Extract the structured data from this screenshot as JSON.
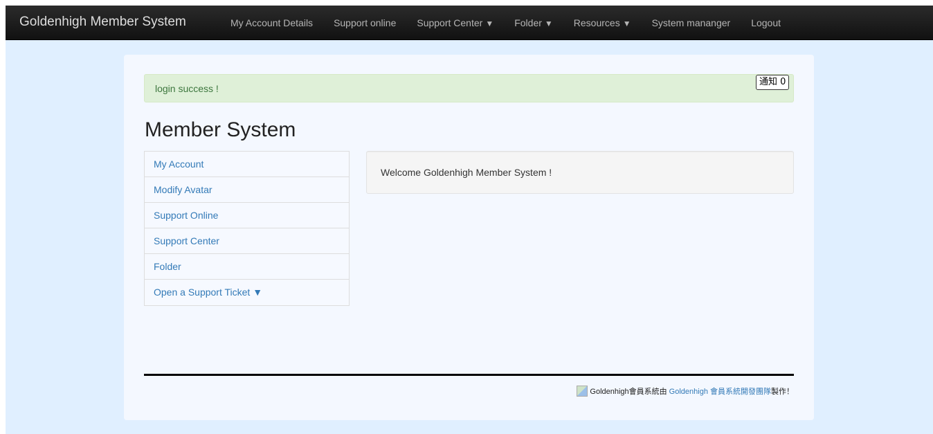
{
  "navbar": {
    "brand": "Goldenhigh Member System",
    "items": [
      {
        "label": "My Account Details",
        "caret": ""
      },
      {
        "label": "Support online",
        "caret": ""
      },
      {
        "label": "Support Center",
        "caret": "▼"
      },
      {
        "label": "Folder",
        "caret": "▼"
      },
      {
        "label": "Resources",
        "caret": "▼"
      },
      {
        "label": "System mananger",
        "caret": ""
      },
      {
        "label": "Logout",
        "caret": ""
      }
    ]
  },
  "alert": {
    "text": "login success !",
    "notice_button": "通知 0"
  },
  "page": {
    "title": "Member System"
  },
  "side_menu": {
    "items": [
      {
        "label": "My Account"
      },
      {
        "label": "Modify Avatar"
      },
      {
        "label": "Support Online"
      },
      {
        "label": "Support Center"
      },
      {
        "label": "Folder"
      },
      {
        "label": "Open a Support Ticket ▼"
      }
    ]
  },
  "welcome": {
    "text": "Welcome Goldenhigh Member System !"
  },
  "footer": {
    "prefix": "Goldenhigh會員系統由",
    "link": "Goldenhigh 會員系統開發團隊",
    "suffix": "製作！"
  },
  "colors": {
    "navbar_bg": "#1a1a1a",
    "page_bg": "#e0efff",
    "link": "#337ab7",
    "alert_bg": "#dff0d8",
    "alert_text": "#3c763d"
  }
}
